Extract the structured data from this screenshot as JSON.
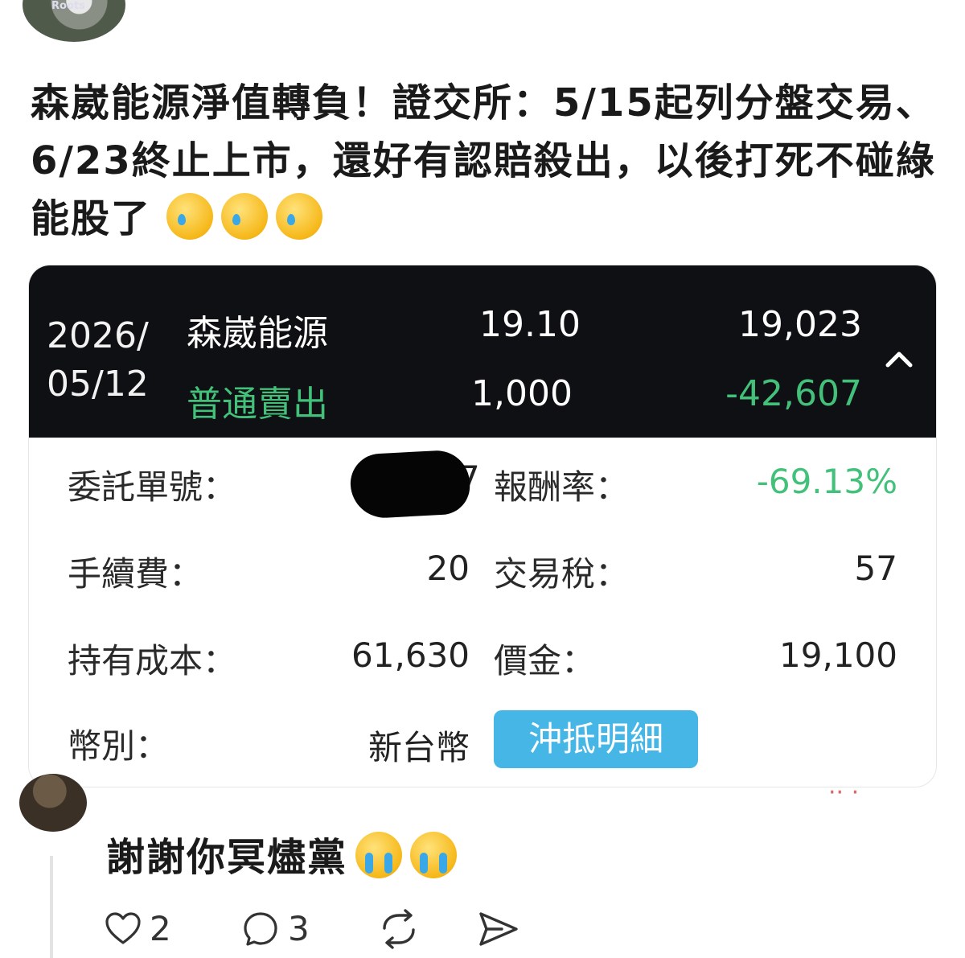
{
  "post": {
    "author": "",
    "time": "",
    "text": "森崴能源淨值轉負！證交所：5/15起列分盤交易、6/23終止上市，還好有認賠殺出，以後打死不碰綠能股了",
    "avatar_text": "Roots",
    "emoji_count": 3
  },
  "trade_card": {
    "date_line1": "2026/",
    "date_line2": "05/12",
    "stock_name": "森崴能源",
    "order_type": "普通賣出",
    "price": "19.10",
    "quantity": "1,000",
    "amount": "19,023",
    "pnl": "-42,607",
    "details": {
      "order_no_label": "委託單號：",
      "order_no_visible": "7",
      "return_rate_label": "報酬率：",
      "return_rate": "-69.13%",
      "fee_label": "手續費：",
      "fee": "20",
      "tax_label": "交易稅：",
      "tax": "57",
      "cost_label": "持有成本：",
      "cost": "61,630",
      "proceeds_label": "價金：",
      "proceeds": "19,100",
      "currency_label": "幣別：",
      "currency": "新台幣",
      "offset_button": "沖抵明細"
    }
  },
  "reply": {
    "author": "",
    "time": "",
    "text": "謝謝你冥燼黨",
    "likes": "2",
    "comments": "3"
  },
  "colors": {
    "card_header_bg": "#0f1013",
    "gain_loss_green": "#43c07a",
    "offset_button_bg": "#45b6e6"
  }
}
